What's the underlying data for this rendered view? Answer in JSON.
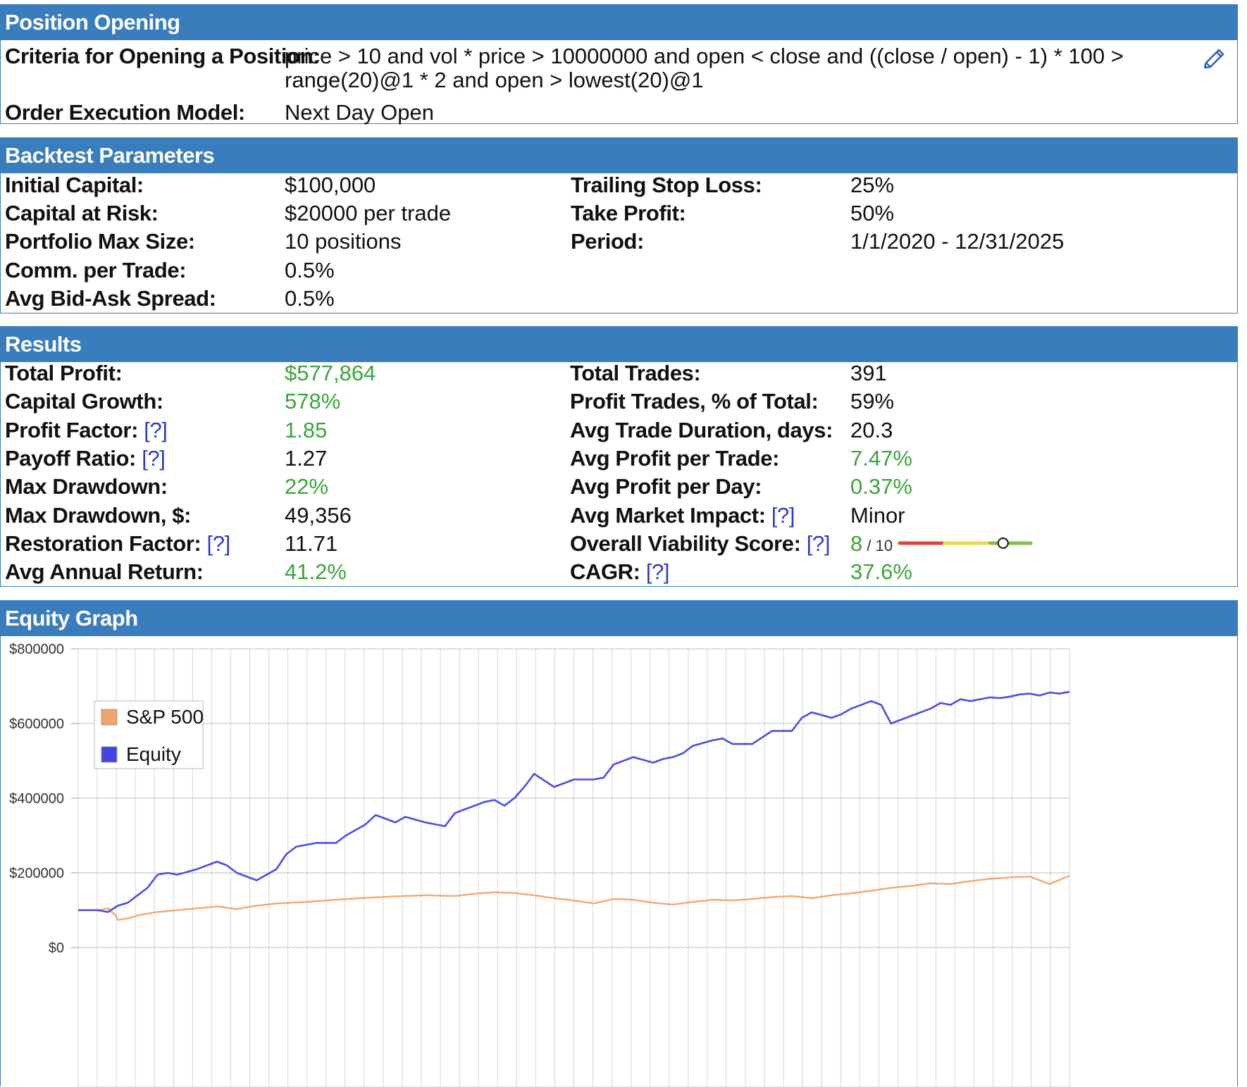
{
  "position_opening": {
    "title": "Position Opening",
    "criteria_label": "Criteria for Opening a Position:",
    "criteria_line1": "price > 10 and vol * price > 10000000 and open < close and ((close / open) - 1) * 100 >",
    "criteria_line2": "range(20)@1 * 2 and open > lowest(20)@1",
    "execution_label": "Order Execution Model:",
    "execution_value": "Next Day Open",
    "edit_icon": "pencil-icon"
  },
  "backtest": {
    "title": "Backtest Parameters",
    "left": [
      {
        "label": "Initial Capital:",
        "value": "$100,000"
      },
      {
        "label": "Capital at Risk:",
        "value": "$20000 per trade"
      },
      {
        "label": "Portfolio Max Size:",
        "value": "10 positions"
      },
      {
        "label": "Comm. per Trade:",
        "value": "0.5%"
      },
      {
        "label": "Avg Bid-Ask Spread:",
        "value": "0.5%"
      }
    ],
    "right": [
      {
        "label": "Trailing Stop Loss:",
        "value": "25%"
      },
      {
        "label": "Take Profit:",
        "value": "50%"
      },
      {
        "label": "Period:",
        "value": "1/1/2020 - 12/31/2025"
      }
    ]
  },
  "results": {
    "title": "Results",
    "help": "[?]",
    "left": [
      {
        "label": "Total Profit:",
        "value": "$577,864"
      },
      {
        "label": "Capital Growth:",
        "value": "578%"
      },
      {
        "label": "Profit Factor:",
        "value": "1.85"
      },
      {
        "label": "Payoff Ratio:",
        "value": "1.27"
      },
      {
        "label": "Max Drawdown:",
        "value": "22%"
      },
      {
        "label": "Max Drawdown, $:",
        "value": "49,356"
      },
      {
        "label": "Restoration Factor:",
        "value": "11.71"
      },
      {
        "label": "Avg Annual Return:",
        "value": "41.2%"
      }
    ],
    "right": [
      {
        "label": "Total Trades:",
        "value": "391"
      },
      {
        "label": "Profit Trades, % of Total:",
        "value": "59%"
      },
      {
        "label": "Avg Trade Duration, days:",
        "value": "20.3"
      },
      {
        "label": "Avg Profit per Trade:",
        "value": "7.47%"
      },
      {
        "label": "Avg Profit per Day:",
        "value": "0.37%"
      },
      {
        "label": "Avg Market Impact:",
        "value": "Minor"
      },
      {
        "label": "Overall Viability Score:",
        "value": "8",
        "suffix": "/ 10"
      },
      {
        "label": "CAGR:",
        "value": "37.6%"
      }
    ],
    "viability_score": 8,
    "viability_max": 10,
    "colors": {
      "good": "#3aa53a",
      "link": "#2e3cbf",
      "bar_red": "#e0433a",
      "bar_yellow": "#e8d84a",
      "bar_green": "#7fc241"
    }
  },
  "equity_graph": {
    "title": "Equity Graph"
  },
  "chart_data": {
    "type": "line",
    "title": "",
    "ylim": [
      0,
      800000
    ],
    "yticks": [
      "$800000",
      "$600000",
      "$400000",
      "$200000",
      "$0"
    ],
    "ytick_values": [
      800000,
      600000,
      400000,
      200000,
      0
    ],
    "grid": true,
    "legend_position": "top-left",
    "x_range": [
      0,
      100
    ],
    "series": [
      {
        "name": "S&P 500",
        "color": "#f0a46c",
        "x": [
          0,
          2,
          3,
          3.8,
          4,
          5,
          6,
          8,
          10,
          12,
          14,
          16,
          18,
          20,
          23,
          26,
          29,
          32,
          35,
          38,
          40,
          42,
          44,
          46,
          48,
          50,
          52,
          54,
          56,
          58,
          60,
          62,
          64,
          66,
          68,
          70,
          72,
          74,
          76,
          78,
          80,
          82,
          84,
          86,
          88,
          90,
          92,
          94,
          96,
          98,
          100
        ],
        "values": [
          100000,
          100000,
          105000,
          85000,
          74000,
          78000,
          86000,
          95000,
          100000,
          105000,
          110000,
          103000,
          112000,
          118000,
          122000,
          128000,
          133000,
          137000,
          140000,
          138000,
          144000,
          148000,
          146000,
          140000,
          132000,
          126000,
          118000,
          130000,
          128000,
          120000,
          115000,
          122000,
          128000,
          126000,
          130000,
          135000,
          138000,
          132000,
          140000,
          145000,
          152000,
          160000,
          165000,
          172000,
          170000,
          178000,
          184000,
          188000,
          190000,
          170000,
          192000
        ]
      },
      {
        "name": "Equity",
        "color": "#4343e0",
        "x": [
          0,
          2,
          3,
          4,
          5,
          6,
          7,
          8,
          9,
          10,
          12,
          14,
          15,
          16,
          18,
          20,
          21,
          22,
          24,
          26,
          27,
          29,
          30,
          31,
          32,
          33,
          35,
          36,
          37,
          38,
          39,
          40,
          41,
          42,
          43,
          44,
          45,
          46,
          48,
          50,
          52,
          53,
          54,
          56,
          58,
          59,
          60,
          61,
          62,
          64,
          65,
          66,
          68,
          70,
          72,
          73,
          74,
          76,
          77,
          78,
          80,
          81,
          82,
          84,
          86,
          87,
          88,
          89,
          90,
          92,
          93,
          94,
          95,
          96,
          97,
          98,
          99,
          100
        ],
        "values": [
          100000,
          100000,
          95000,
          112000,
          120000,
          140000,
          160000,
          195000,
          200000,
          195000,
          210000,
          230000,
          220000,
          200000,
          180000,
          210000,
          250000,
          270000,
          280000,
          280000,
          300000,
          330000,
          355000,
          345000,
          335000,
          350000,
          335000,
          330000,
          325000,
          360000,
          370000,
          380000,
          390000,
          395000,
          380000,
          400000,
          430000,
          465000,
          430000,
          450000,
          450000,
          455000,
          490000,
          510000,
          495000,
          505000,
          510000,
          520000,
          540000,
          555000,
          560000,
          545000,
          545000,
          580000,
          580000,
          615000,
          630000,
          615000,
          625000,
          640000,
          660000,
          650000,
          600000,
          620000,
          640000,
          655000,
          650000,
          665000,
          660000,
          670000,
          668000,
          672000,
          678000,
          680000,
          675000,
          683000,
          680000,
          685000
        ]
      }
    ]
  }
}
